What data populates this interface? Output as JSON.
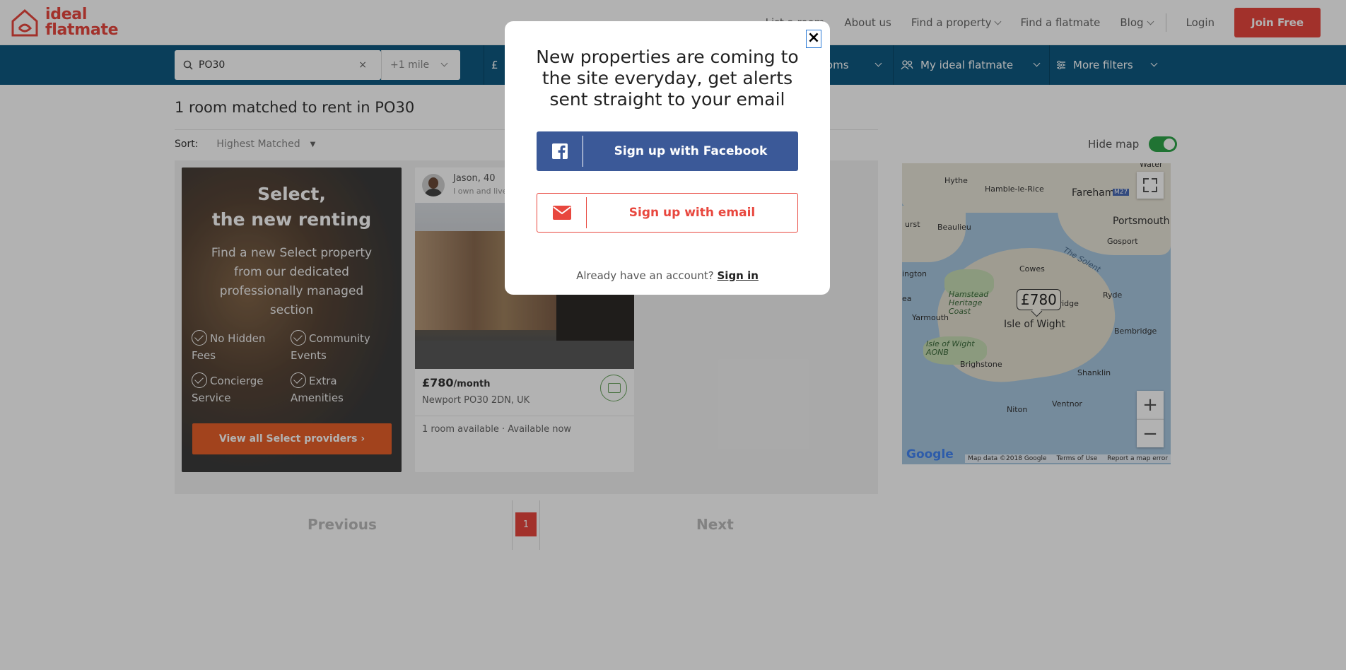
{
  "header": {
    "logo_line1": "ideal",
    "logo_line2": "flatmate",
    "nav": {
      "list_room": "List a room",
      "about": "About us",
      "find_property": "Find a property",
      "find_flatmate": "Find a flatmate",
      "blog": "Blog",
      "login": "Login",
      "join": "Join Free"
    }
  },
  "filters": {
    "search_value": "PO30",
    "clear": "×",
    "radius": "+1 mile",
    "price_symbol": "£",
    "rooms": "Rooms",
    "my_ideal": "My ideal flatmate",
    "more": "More filters"
  },
  "results": {
    "heading": "1 room matched to rent in PO30",
    "sort_label": "Sort:",
    "sort_value": "Highest Matched",
    "hide_map": "Hide map"
  },
  "select_promo": {
    "title_line1": "Select,",
    "title_line2": "the new renting",
    "description": "Find a new Select property from our dedicated professionally managed section",
    "features": [
      "No Hidden Fees",
      "Community Events",
      "Concierge Service",
      "Extra Amenities"
    ],
    "button": "View all Select providers ›"
  },
  "listing_card": {
    "owner": "Jason, 40",
    "owner_note": "I own and live in this property",
    "price": "£780",
    "price_unit": "/month",
    "address": "Newport PO30 2DN, UK",
    "availability": "1 room available · Available now"
  },
  "map": {
    "pin_price": "£780",
    "labels": {
      "hythe": "Hythe",
      "hamble": "Hamble-le-Rice",
      "fareham": "Fareham",
      "m27": "M27",
      "portsmouth": "Portsmouth",
      "gosport": "Gosport",
      "beaulieu": "Beaulieu",
      "cowes": "Cowes",
      "solent": "The Solent",
      "lymington": "ington",
      "hamstead": "Hamstead Heritage Coast",
      "ryde": "Ryde",
      "bridge": "Bridge",
      "yarmouth": "Yarmouth",
      "isle": "Isle of Wight",
      "bembridge": "Bembridge",
      "aonb": "Isle of Wight AONB",
      "brighstone": "Brighstone",
      "shanklin": "Shanklin",
      "ventnor": "Ventnor",
      "niton": "Niton",
      "water": "Water",
      "urst": "urst",
      "ea": "ea"
    },
    "zoom_in": "+",
    "zoom_out": "−",
    "google": "Google",
    "footer": {
      "data": "Map data ©2018 Google",
      "terms": "Terms of Use",
      "report": "Report a map error"
    }
  },
  "pagination": {
    "previous": "Previous",
    "page": "1",
    "next": "Next"
  },
  "modal": {
    "close": "×",
    "title": "New properties are coming to the site everyday, get alerts sent straight to your email",
    "facebook": "Sign up with Facebook",
    "email": "Sign up with email",
    "already": "Already have an account?",
    "signin": "Sign in"
  },
  "colors": {
    "brand": "#e8473e",
    "nav_bar": "#0f5a82",
    "facebook": "#3b5998",
    "select_orange": "#e8612a",
    "toggle_green": "#2fa54a"
  }
}
